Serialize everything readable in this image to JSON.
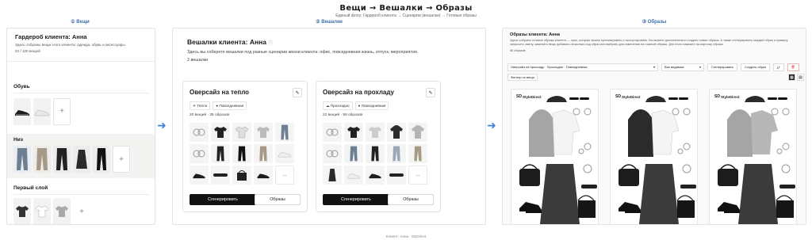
{
  "header": {
    "title": "Вещи → Вешалки → Образы",
    "subtitle": "Единый флоу: Гардероб клиента → Сценарии (вешалки) → Готовые образы"
  },
  "steps": [
    "① Вещи",
    "② Вешалки",
    "③ Образы"
  ],
  "wardrobe": {
    "title": "Гардероб клиента: Анна",
    "description": "Здесь собраны вещи этого клиента: одежда, обувь и аксессуары.",
    "count": "22 / 100 вещей",
    "categories": [
      {
        "label": "Обувь"
      },
      {
        "label": "Низ"
      },
      {
        "label": "Первый слой"
      }
    ],
    "add_glyph": "+"
  },
  "hangers": {
    "title": "Вешалки клиента: Анна",
    "info_glyph": "ⓘ",
    "description": "Здесь вы соберете вешалки под разные сценарии жизни клиента: офис, повседневная жизнь, отпуск, мероприятия.",
    "count": "2 вешалки",
    "cards": [
      {
        "title": "Оверсайз на тепло",
        "tags": [
          "Тепло",
          "Повседневная"
        ],
        "stats": "20 вещей · 35 образов",
        "more": "...",
        "generate": "Сгенерировать",
        "looks": "Образы"
      },
      {
        "title": "Оверсайз на прохладу",
        "tags": [
          "Прохладно",
          "Повседневная"
        ],
        "stats": "22 вещей · 59 образов",
        "more": "...",
        "generate": "Сгенерировать",
        "looks": "Образы"
      }
    ]
  },
  "looks": {
    "title": "Образы клиента: Анна",
    "description": "Здесь собраны готовые образы клиента — луки, которые можно просматривать и экспортировать. Вы можете дополнительно создать новые образы. А также сгенерировать каждый образ к примеру запросить смену, заменить вещь добавить несколько под образ или выбрать для изменения на главной образы. Для этого нажмите на карточку образа.",
    "count": "56 образов",
    "filter": "Оверсайз на прохладу · Прохладно · Повседневная",
    "filter_all": "Все видимые",
    "btn_generate": "Сгенерировать",
    "btn_create": "Создать образ",
    "chip": "Фильтр по вещи",
    "brand": "StyleDirect",
    "brand_mark": "SD"
  },
  "footer": "Клиент: Анна · MyDirect"
}
